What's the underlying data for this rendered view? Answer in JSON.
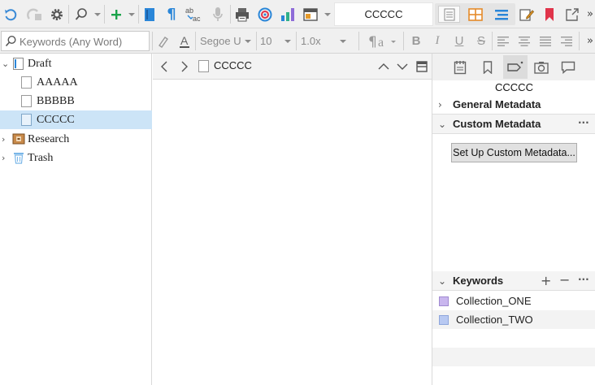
{
  "toolbar": {
    "icons": [
      "undo-icon",
      "redo-icon",
      "gear-icon",
      "search-icon",
      "add-icon",
      "composition-icon",
      "paragraph-icon",
      "spelling-icon",
      "microphone-icon",
      "printer-icon",
      "target-icon",
      "statistics-icon",
      "layout-icon"
    ],
    "document_title": "CCCCC",
    "view_modes": [
      "scrivenings-icon",
      "corkboard-icon",
      "outline-icon"
    ],
    "right_icons": [
      "edit-icon",
      "bookmark-icon",
      "share-icon"
    ],
    "more_glyph": "»"
  },
  "format_bar": {
    "search_placeholder": "Keywords (Any Word)",
    "font_name": "Segoe U",
    "font_size": "10",
    "line_spacing": "1.0x",
    "bold": "B",
    "italic": "I",
    "underline": "U",
    "strike": "S"
  },
  "binder": {
    "items": [
      {
        "label": "Draft",
        "icon": "draft-folder-icon",
        "expanded": true
      },
      {
        "label": "AAAAA",
        "icon": "document-icon"
      },
      {
        "label": "BBBBB",
        "icon": "document-icon"
      },
      {
        "label": "CCCCC",
        "icon": "document-icon",
        "selected": true
      },
      {
        "label": "Research",
        "icon": "research-folder-icon",
        "expanded": false
      },
      {
        "label": "Trash",
        "icon": "trash-icon",
        "expanded": false
      }
    ]
  },
  "editor": {
    "title": "CCCCC"
  },
  "inspector": {
    "tabs": [
      "notes-icon",
      "bookmarks-icon",
      "metadata-icon",
      "snapshots-icon",
      "comments-icon"
    ],
    "active_tab": "metadata-icon",
    "doc_title": "CCCCC",
    "general_metadata": "General Metadata",
    "custom_metadata": "Custom Metadata",
    "setup_button": "Set Up Custom Metadata...",
    "keywords_header": "Keywords",
    "keywords": [
      {
        "label": "Collection_ONE",
        "color": "#c9b6ee"
      },
      {
        "label": "Collection_TWO",
        "color": "#b8c9f2"
      }
    ]
  },
  "colors": {
    "selection": "#cce4f7",
    "accent_blue": "#3a8ad6",
    "green_add": "#1aa34a",
    "red_bookmark": "#e0344a"
  }
}
